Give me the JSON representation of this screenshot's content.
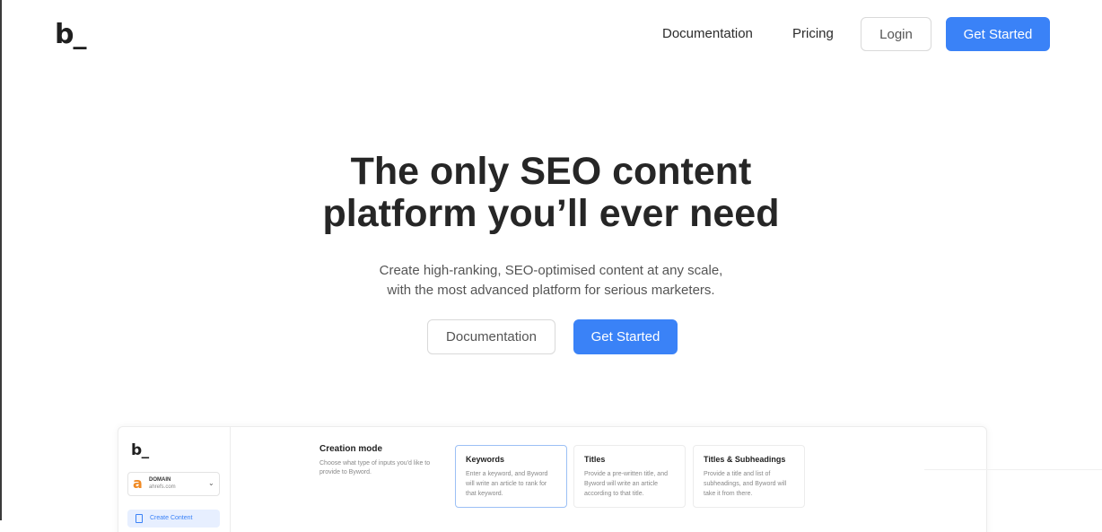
{
  "header": {
    "logo": "b_",
    "nav": {
      "documentation": "Documentation",
      "pricing": "Pricing",
      "login": "Login",
      "get_started": "Get Started"
    }
  },
  "hero": {
    "title_line1": "The only SEO content",
    "title_line2": "platform you’ll ever need",
    "subtitle_line1": "Create high-ranking, SEO-optimised content at any scale,",
    "subtitle_line2": "with the most advanced platform for serious marketers.",
    "documentation_button": "Documentation",
    "get_started_button": "Get Started"
  },
  "preview": {
    "logo": "b_",
    "domain": {
      "icon": "a",
      "label": "DOMAIN",
      "url": "ahrefs.com"
    },
    "create_content": "Create Content",
    "creation_mode": {
      "title": "Creation mode",
      "description": "Choose what type of inputs you'd like to provide to Byword."
    },
    "cards": [
      {
        "title": "Keywords",
        "description": "Enter a keyword, and Byword will write an article to rank for that keyword.",
        "selected": true
      },
      {
        "title": "Titles",
        "description": "Provide a pre-written title, and Byword will write an article according to that title.",
        "selected": false
      },
      {
        "title": "Titles & Subheadings",
        "description": "Provide a title and list of subheadings, and Byword will take it from there.",
        "selected": false
      }
    ]
  },
  "colors": {
    "primary": "#3a82f7",
    "text": "#262626",
    "muted": "#555555",
    "domain_icon": "#f08a24"
  }
}
